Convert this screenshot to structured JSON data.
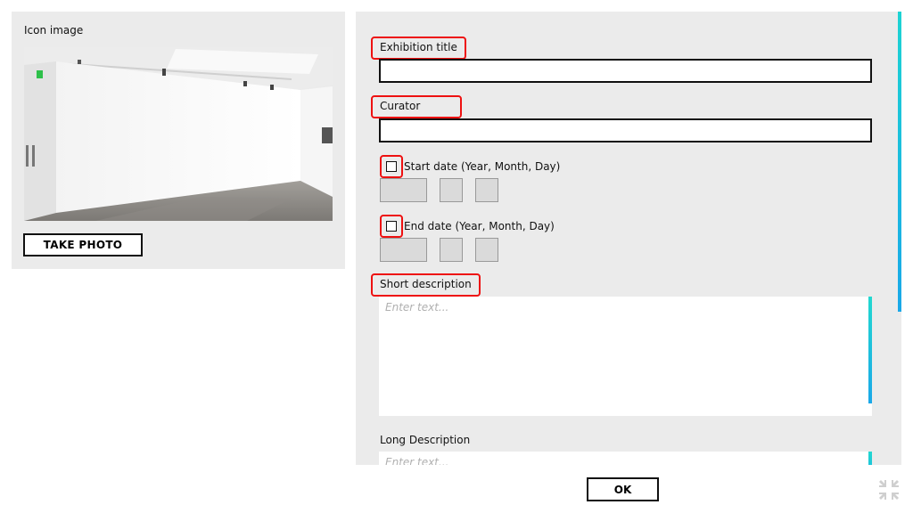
{
  "left": {
    "icon_label": "Icon image",
    "take_photo_label": "TAKE PHOTO"
  },
  "form": {
    "exhibition_title_label": "Exhibition title",
    "exhibition_title_value": "",
    "curator_label": "Curator",
    "curator_value": "",
    "start_date_label": "Start date (Year, Month, Day)",
    "end_date_label": "End date (Year, Month, Day)",
    "short_description_label": "Short description",
    "short_description_placeholder": "Enter text...",
    "long_description_label": "Long Description",
    "long_description_placeholder": "Enter text..."
  },
  "footer": {
    "ok_label": "OK"
  },
  "colors": {
    "highlight": "#e11111",
    "scroll_accent": "#1dd3d3",
    "panel_bg": "#ebebeb"
  },
  "icons": {
    "collapse": "collapse-arrows-icon"
  }
}
